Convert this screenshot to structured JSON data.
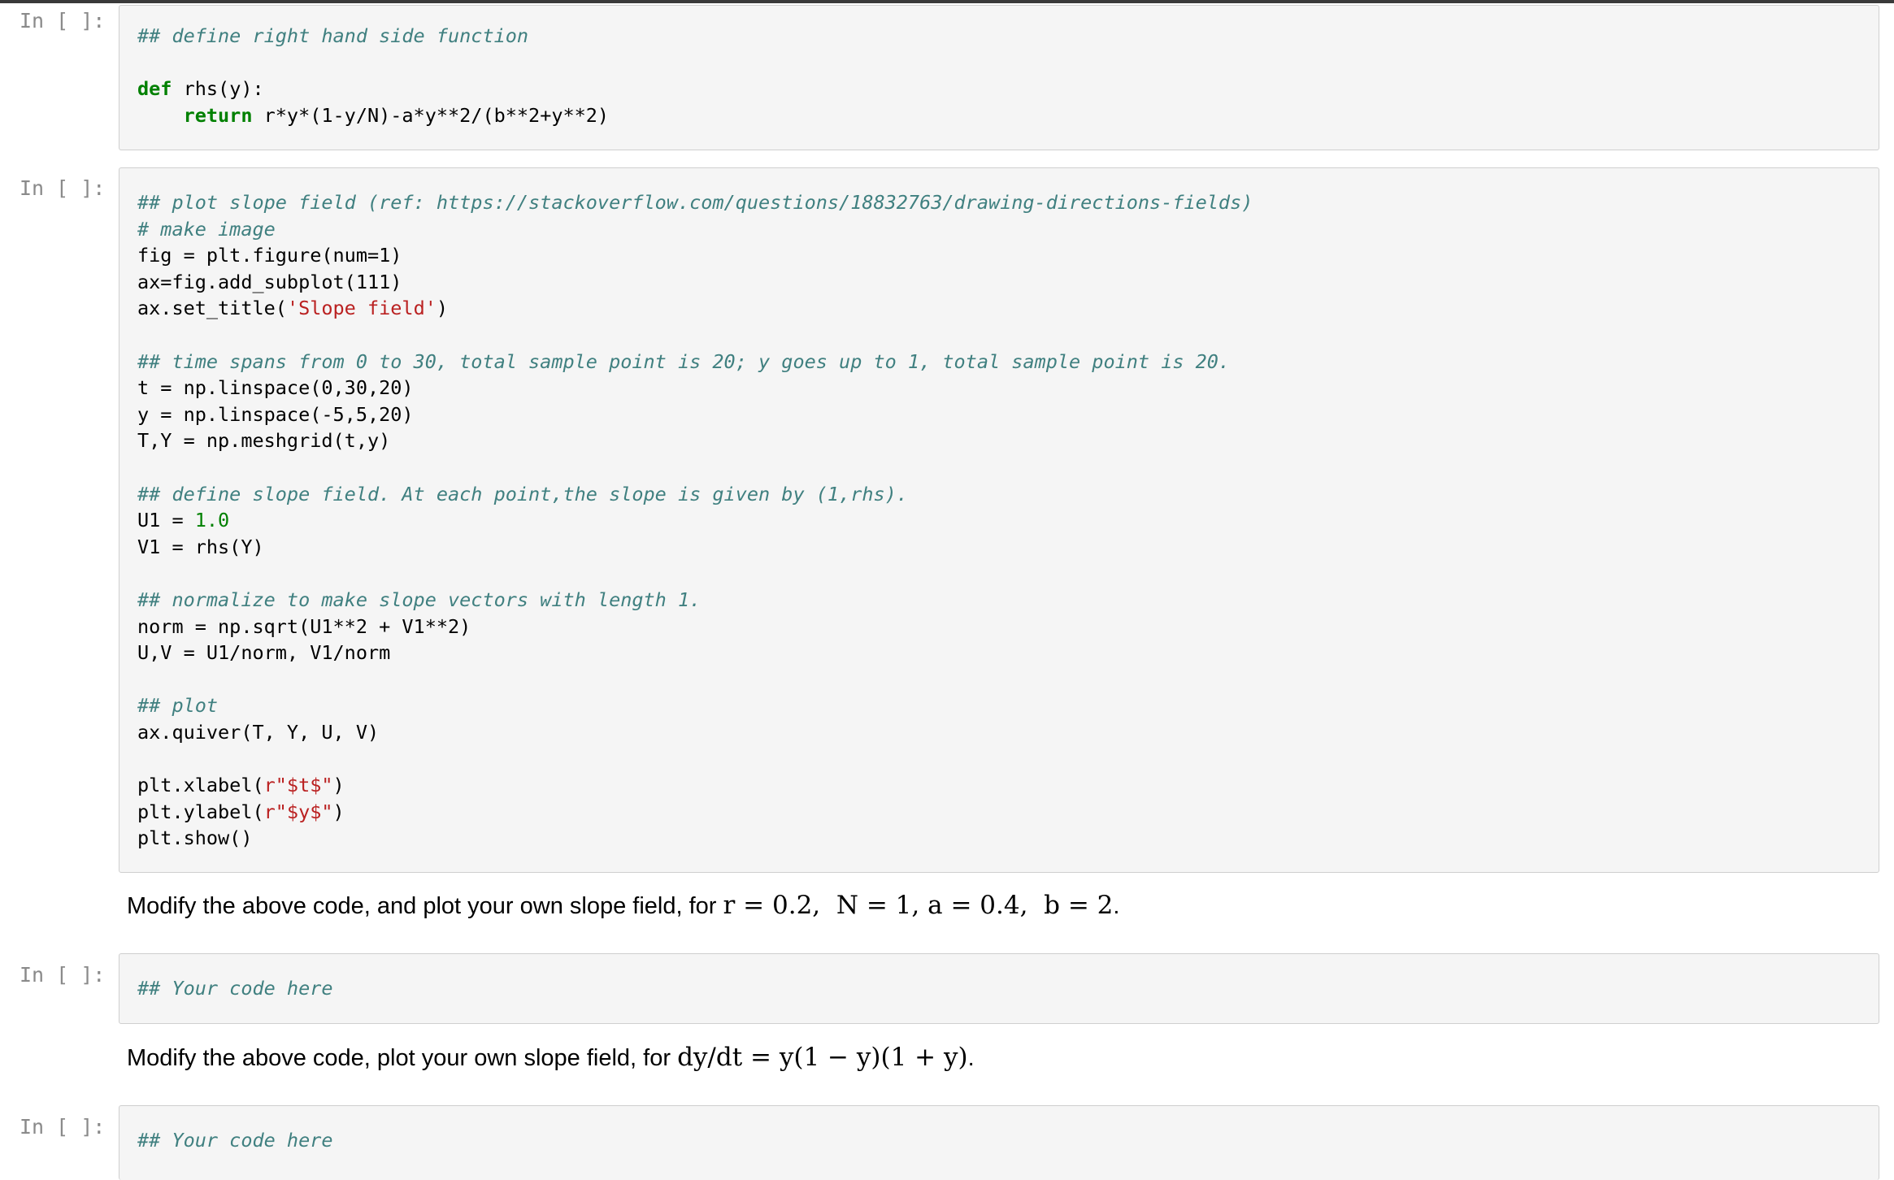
{
  "notebook": {
    "prompts": [
      "In [ ]:",
      "In [ ]:",
      "In [ ]:",
      "In [ ]:"
    ],
    "cell1": {
      "comment": "## define right hand side function",
      "def_kw": "def",
      "def_rest": " rhs(y):",
      "return_kw": "return",
      "return_expr": " r*y*(1-y/N)-a*y**2/(b**2+y**2)"
    },
    "cell2": {
      "c1": "## plot slope field (ref: https://stackoverflow.com/questions/18832763/drawing-directions-fields)",
      "c2": "# make image",
      "l3": "fig = plt.figure(num=1)",
      "l4": "ax=fig.add_subplot(111)",
      "l5a": "ax.set_title(",
      "l5s": "'Slope field'",
      "l5b": ")",
      "c7": "## time spans from 0 to 30, total sample point is 20; y goes up to 1, total sample point is 20.",
      "l8": "t = np.linspace(0,30,20)",
      "l9": "y = np.linspace(-5,5,20)",
      "l10": "T,Y = np.meshgrid(t,y)",
      "c12": "## define slope field. At each point,the slope is given by (1,rhs).",
      "l13a": "U1 = ",
      "l13n": "1.0",
      "l14": "V1 = rhs(Y)",
      "c16": "## normalize to make slope vectors with length 1.",
      "l17": "norm = np.sqrt(U1**2 + V1**2)",
      "l18": "U,V = U1/norm, V1/norm",
      "c20": "## plot",
      "l21": "ax.quiver(T, Y, U, V)",
      "l23a": "plt.xlabel(",
      "l23s": "r\"$t$\"",
      "l23b": ")",
      "l24a": "plt.ylabel(",
      "l24s": "r\"$y$\"",
      "l24b": ")",
      "l25": "plt.show()"
    },
    "markdown1": {
      "text": "Modify the above code, and plot your own slope field, for ",
      "math": "r = 0.2,  N = 1, a = 0.4,  b = 2",
      "end": "."
    },
    "cell3": {
      "comment": "## Your code here"
    },
    "markdown2": {
      "text": "Modify the above code, plot your own slope field, for ",
      "math": "dy/dt = y(1 − y)(1 + y)",
      "end": "."
    },
    "cell4": {
      "comment": "## Your code here"
    }
  }
}
